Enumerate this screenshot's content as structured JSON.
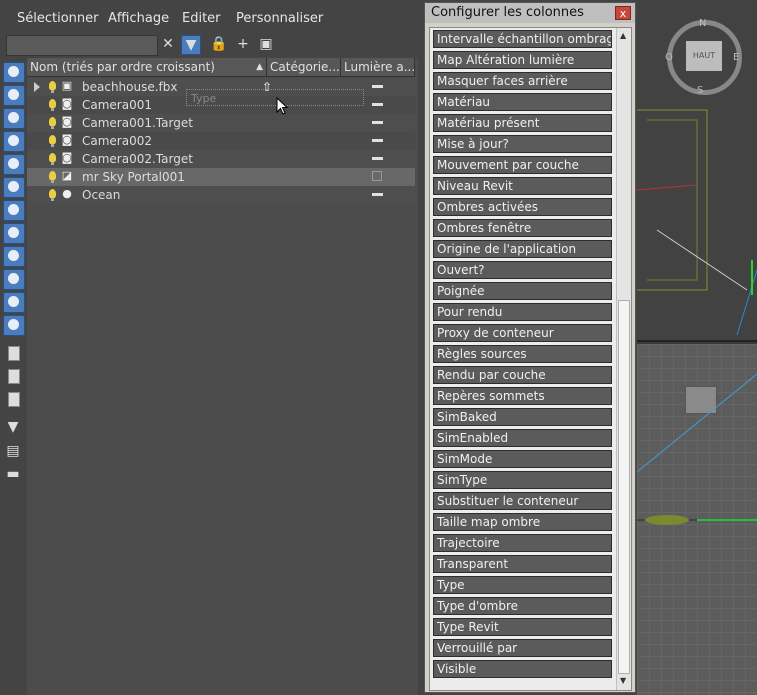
{
  "menu": [
    "Sélectionner",
    "Affichage",
    "Editer",
    "Personnaliser"
  ],
  "columns": {
    "name": "Nom (triés par ordre croissant)",
    "category": "Catégorie...",
    "light": "Lumière a..."
  },
  "drag_ghost_label": "Type",
  "scene_rows": [
    {
      "name": "beachhouse.fbx",
      "icon": "file-icon",
      "light_state": "dash",
      "expandable": true
    },
    {
      "name": "Camera001",
      "icon": "camera-icon",
      "light_state": "dash"
    },
    {
      "name": "Camera001.Target",
      "icon": "camera-icon",
      "light_state": "dash"
    },
    {
      "name": "Camera002",
      "icon": "camera-icon",
      "light_state": "dash"
    },
    {
      "name": "Camera002.Target",
      "icon": "camera-icon",
      "light_state": "dash"
    },
    {
      "name": "mr Sky Portal001",
      "icon": "sky-portal-icon",
      "light_state": "checkbox",
      "selected": true
    },
    {
      "name": "Ocean",
      "icon": "sphere-icon",
      "light_state": "dash"
    }
  ],
  "dialog": {
    "title": "Configurer les colonnes",
    "close_label": "x",
    "items": [
      "Intervalle échantillon ombrage",
      "Map Altération lumière",
      "Masquer faces arrière",
      "Matériau",
      "Matériau présent",
      "Mise à jour?",
      "Mouvement par couche",
      "Niveau Revit",
      "Ombres activées",
      "Ombres fenêtre",
      "Origine de l'application",
      "Ouvert?",
      "Poignée",
      "Pour rendu",
      "Proxy de conteneur",
      "Règles sources",
      "Rendu par couche",
      "Repères sommets",
      "SimBaked",
      "SimEnabled",
      "SimMode",
      "SimType",
      "Substituer le conteneur",
      "Taille map ombre",
      "Trajectoire",
      "Transparent",
      "Type",
      "Type d'ombre",
      "Type Revit",
      "Verrouillé par",
      "Visible"
    ]
  },
  "viewcube": {
    "face": "HAUT",
    "north": "N",
    "south": "S",
    "east": "E",
    "west": "O"
  },
  "colors": {
    "panel": "#444444",
    "dialog": "#d4d0c8",
    "list_item": "#5b5b5b",
    "selected_row": "#686868",
    "accent_blue": "#4a7dbd"
  }
}
